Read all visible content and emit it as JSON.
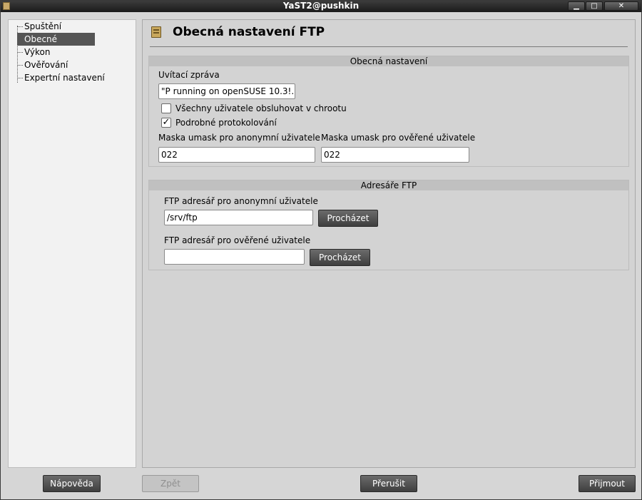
{
  "window": {
    "title": "YaST2@pushkin",
    "buttons": {
      "minimize": "▁",
      "maximize": "□",
      "close": "✕"
    }
  },
  "sidebar": {
    "items": [
      {
        "label": "Spuštění"
      },
      {
        "label": "Obecné",
        "selected": true
      },
      {
        "label": "Výkon"
      },
      {
        "label": "Ověřování"
      },
      {
        "label": "Expertní nastavení"
      }
    ]
  },
  "main": {
    "title": "Obecná nastavení FTP",
    "general": {
      "title": "Obecná nastavení",
      "welcome_label": "Uvítací zpráva",
      "welcome_value": "\"P running on openSUSE 10.3!.\"",
      "chroot_label": "Všechny uživatele obsluhovat v chrootu",
      "chroot_checked": false,
      "verbose_label": "Podrobné protokolování",
      "verbose_checked": true,
      "verbose_mark": "✓",
      "umask_anon_label": "Maska umask pro anonymní uživatele",
      "umask_anon_value": "022",
      "umask_auth_label": "Maska umask pro ověřené uživatele",
      "umask_auth_value": "022"
    },
    "dirs": {
      "title": "Adresáře FTP",
      "anon_label": "FTP adresář pro anonymní uživatele",
      "anon_value": "/srv/ftp",
      "auth_label": "FTP adresář pro ověřené uživatele",
      "auth_value": "",
      "browse_label": "Procházet"
    }
  },
  "footer": {
    "help": "Nápověda",
    "back": "Zpět",
    "abort": "Přerušit",
    "accept": "Přijmout"
  }
}
